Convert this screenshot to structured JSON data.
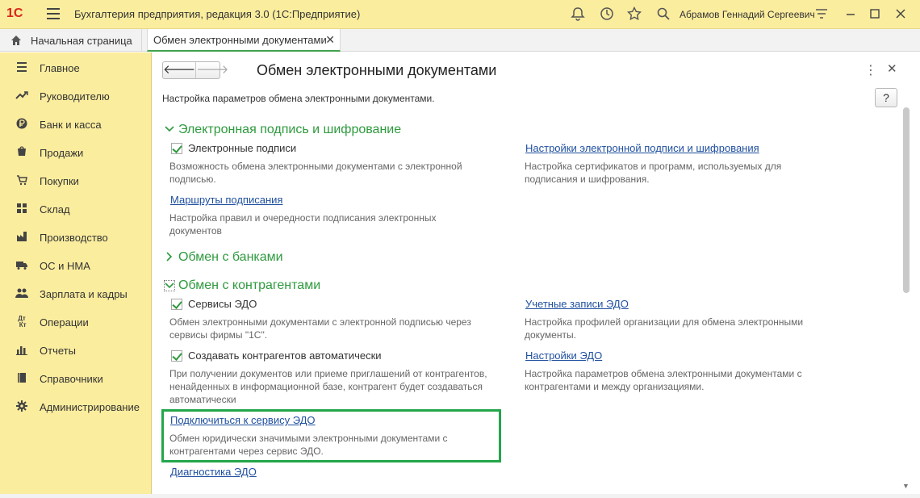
{
  "window": {
    "logo_text": "1С",
    "title": "Бухгалтерия предприятия, редакция 3.0  (1С:Предприятие)",
    "user": "Абрамов Геннадий Сергеевич"
  },
  "tabs": {
    "home": "Начальная страница",
    "active": "Обмен электронными документами"
  },
  "sidebar": {
    "items": [
      {
        "label": "Главное",
        "icon": "menu-icon"
      },
      {
        "label": "Руководителю",
        "icon": "trend-icon"
      },
      {
        "label": "Банк и касса",
        "icon": "ruble-icon"
      },
      {
        "label": "Продажи",
        "icon": "cart-icon"
      },
      {
        "label": "Покупки",
        "icon": "basket-icon"
      },
      {
        "label": "Склад",
        "icon": "warehouse-icon"
      },
      {
        "label": "Производство",
        "icon": "factory-icon"
      },
      {
        "label": "ОС и НМА",
        "icon": "truck-icon"
      },
      {
        "label": "Зарплата и кадры",
        "icon": "people-icon"
      },
      {
        "label": "Операции",
        "icon": "dt-kt-icon"
      },
      {
        "label": "Отчеты",
        "icon": "chart-icon"
      },
      {
        "label": "Справочники",
        "icon": "book-icon"
      },
      {
        "label": "Администрирование",
        "icon": "gear-icon"
      }
    ]
  },
  "form": {
    "title": "Обмен электронными документами",
    "description": "Настройка параметров обмена электронными документами.",
    "help_label": "?"
  },
  "sections": {
    "signature": {
      "title": "Электронная подпись и шифрование",
      "checkbox_signatures": "Электронные подписи",
      "signatures_note": "Возможность обмена электронными документами с электронной подписью.",
      "link_routes": "Маршруты подписания",
      "routes_note": "Настройка правил и очередности подписания электронных документов",
      "link_settings": "Настройки электронной подписи и шифрования",
      "settings_note": "Настройка сертификатов и программ, используемых для подписания и шифрования."
    },
    "banks": {
      "title": "Обмен с банками"
    },
    "counterparties": {
      "title": "Обмен с контрагентами",
      "checkbox_services": "Сервисы ЭДО",
      "services_note": "Обмен электронными документами с электронной подписью через сервисы фирмы \"1С\".",
      "link_accounts": "Учетные записи ЭДО",
      "accounts_note": "Настройка профилей организации для обмена электронными документы.",
      "checkbox_auto": "Создавать контрагентов автоматически",
      "auto_note": "При получении документов или приеме приглашений от контрагентов, ненайденных в информационной базе, контрагент будет создаваться автоматически",
      "link_edo_settings": "Настройки ЭДО",
      "edo_settings_note": "Настройка параметров обмена электронными документами с контрагентами и между организациями.",
      "link_connect": "Подключиться к сервису ЭДО",
      "connect_note": "Обмен юридически значимыми электронными документами с контрагентами через сервис ЭДО.",
      "link_diagnostics": "Диагностика ЭДО"
    }
  },
  "colors": {
    "accent_green": "#2e9a3e",
    "highlight_green": "#22a64a",
    "link_blue": "#1f4f9f",
    "panel_yellow": "#fbed9e"
  }
}
